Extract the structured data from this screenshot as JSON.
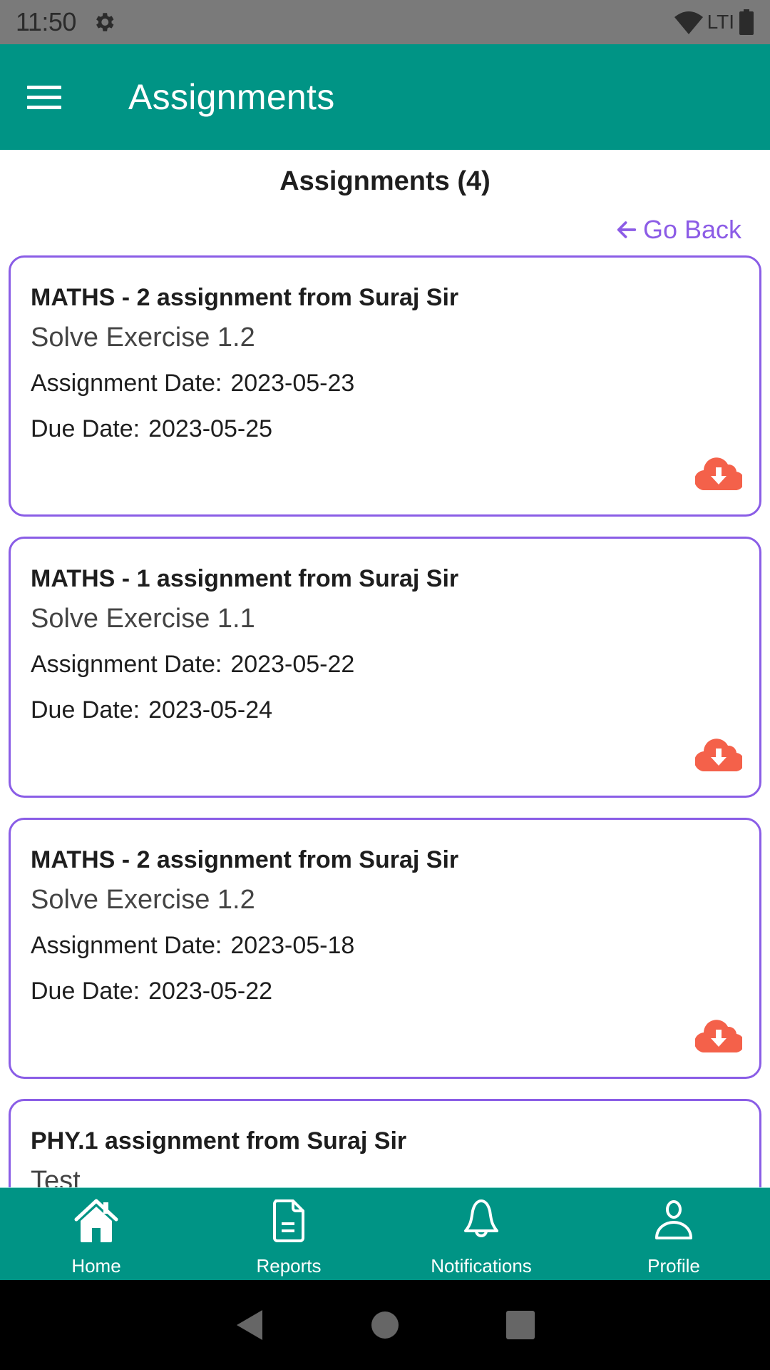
{
  "status_bar": {
    "time": "11:50",
    "network": "LTE"
  },
  "app_bar": {
    "title": "Assignments",
    "menu_icon": "hamburger-menu-icon"
  },
  "page": {
    "heading": "Assignments (4)",
    "go_back_label": "Go Back"
  },
  "assignments": [
    {
      "title": "MATHS - 2 assignment from Suraj Sir",
      "subtitle": "Solve Exercise 1.2",
      "assignment_date_label": "Assignment Date:",
      "assignment_date": "2023-05-23",
      "due_date_label": "Due Date:",
      "due_date": "2023-05-25"
    },
    {
      "title": "MATHS - 1 assignment from Suraj Sir",
      "subtitle": "Solve Exercise 1.1",
      "assignment_date_label": "Assignment Date:",
      "assignment_date": "2023-05-22",
      "due_date_label": "Due Date:",
      "due_date": "2023-05-24"
    },
    {
      "title": "MATHS - 2 assignment from Suraj Sir",
      "subtitle": "Solve Exercise 1.2",
      "assignment_date_label": "Assignment Date:",
      "assignment_date": "2023-05-18",
      "due_date_label": "Due Date:",
      "due_date": "2023-05-22"
    },
    {
      "title": "PHY.1 assignment from Suraj Sir",
      "subtitle": "Test"
    }
  ],
  "bottom_nav": {
    "items": [
      {
        "label": "Home",
        "icon": "home-icon"
      },
      {
        "label": "Reports",
        "icon": "document-icon"
      },
      {
        "label": "Notifications",
        "icon": "bell-icon"
      },
      {
        "label": "Profile",
        "icon": "user-icon"
      }
    ]
  },
  "colors": {
    "primary": "#009485",
    "accent": "#8a5de6",
    "download": "#f4614a",
    "status_bar": "#7a7a7a"
  }
}
